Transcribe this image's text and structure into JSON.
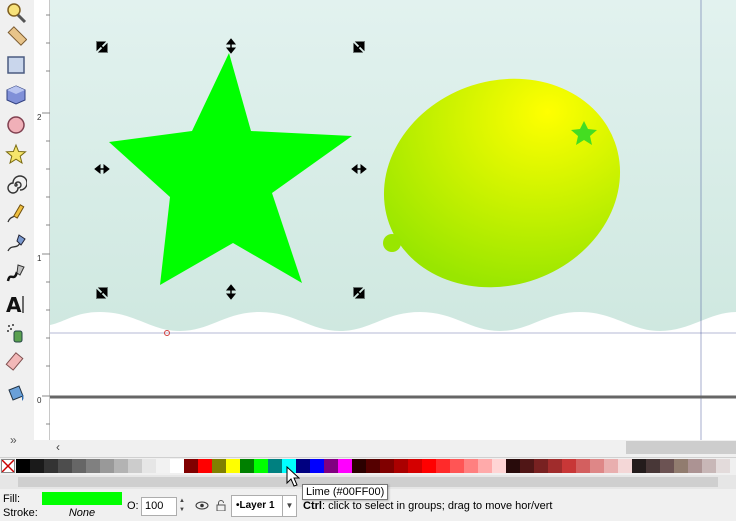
{
  "toolbox": {
    "tools": [
      {
        "name": "zoom-tool",
        "icon": "magnifier-icon"
      },
      {
        "name": "measure-tool",
        "icon": "ruler-icon"
      },
      {
        "name": "rectangle-tool",
        "icon": "square-icon"
      },
      {
        "name": "3d-box-tool",
        "icon": "cube-icon"
      },
      {
        "name": "ellipse-tool",
        "icon": "circle-icon"
      },
      {
        "name": "star-tool",
        "icon": "star-icon"
      },
      {
        "name": "spiral-tool",
        "icon": "spiral-icon"
      },
      {
        "name": "pencil-tool",
        "icon": "pencil-icon"
      },
      {
        "name": "pen-tool",
        "icon": "pen-icon"
      },
      {
        "name": "calligraphy-tool",
        "icon": "calligraphy-icon"
      },
      {
        "name": "text-tool",
        "icon": "text-a-icon"
      },
      {
        "name": "spray-tool",
        "icon": "spray-icon"
      },
      {
        "name": "eraser-tool",
        "icon": "eraser-icon"
      },
      {
        "name": "paint-bucket-tool",
        "icon": "bucket-icon"
      }
    ],
    "more": "»"
  },
  "ruler": {
    "labels": [
      "2",
      "1",
      "0"
    ]
  },
  "canvas": {
    "star_color": "#00ff00",
    "lemon_gradient_start": "#ffff00",
    "lemon_gradient_end": "#99e600",
    "lemon_star_color": "#44dd22",
    "background_top": "#e2f2ef",
    "background_bottom": "#cfe8e0",
    "guide_color": "#2a3a8a"
  },
  "palette": {
    "colors": [
      "#000000",
      "#1a1a1a",
      "#333333",
      "#4d4d4d",
      "#666666",
      "#808080",
      "#999999",
      "#b3b3b3",
      "#cccccc",
      "#e6e6e6",
      "#f2f2f2",
      "#ffffff",
      "#800000",
      "#ff0000",
      "#808000",
      "#ffff00",
      "#008000",
      "#00ff00",
      "#008080",
      "#00ffff",
      "#000080",
      "#0000ff",
      "#800080",
      "#ff00ff",
      "#2b0000",
      "#550000",
      "#800000",
      "#aa0000",
      "#d40000",
      "#ff0000",
      "#ff2a2a",
      "#ff5555",
      "#ff8080",
      "#ffaaaa",
      "#ffd5d5",
      "#280b0b",
      "#501616",
      "#782121",
      "#a02c2c",
      "#c83737",
      "#d35f5f",
      "#de8787",
      "#e9afaf",
      "#f4d7d7",
      "#241c1c",
      "#483737",
      "#6c5353",
      "#917c6f",
      "#ac9393",
      "#c8b7b7",
      "#e3dbdb"
    ]
  },
  "statusbar": {
    "fill_label": "Fill:",
    "stroke_label": "Stroke:",
    "stroke_value": "None",
    "fill_color": "#00ff00",
    "opacity_label": "O:",
    "opacity_value": "100",
    "layer_name": "•Layer 1",
    "message_ctrl": "Ctrl",
    "message_rest": ": click to select in groups; drag to move hor/vert"
  },
  "tooltip": {
    "text": "Lime (#00FF00)"
  }
}
